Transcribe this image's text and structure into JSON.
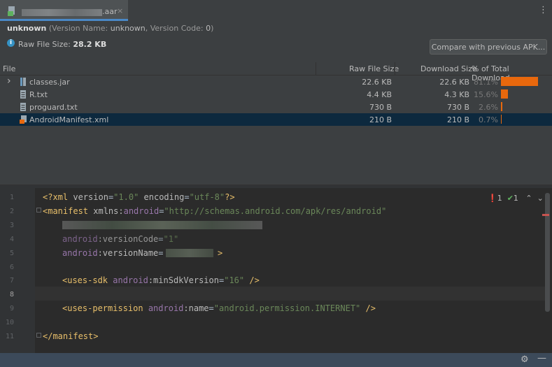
{
  "tab": {
    "filename_ext": ".aar",
    "close": "×"
  },
  "header": {
    "name": "unknown",
    "version_name_label": "(Version Name: ",
    "version_name": "unknown",
    "version_code_label": ", Version Code: ",
    "version_code": "0",
    "version_close": ")",
    "raw_size_label": "Raw File Size: ",
    "raw_size": "28.2 KB",
    "compare_button": "Compare with previous APK..."
  },
  "table": {
    "columns": [
      "File",
      "Raw File Size",
      "Download Size",
      "% of Total Download..."
    ],
    "rows": [
      {
        "name": "classes.jar",
        "raw": "22.6 KB",
        "download": "22.6 KB",
        "percent": "81.1%",
        "percent_value": 81.1,
        "icon": "jar-icon",
        "expandable": true
      },
      {
        "name": "R.txt",
        "raw": "4.4 KB",
        "download": "4.3 KB",
        "percent": "15.6%",
        "percent_value": 15.6,
        "icon": "text-file-icon",
        "expandable": false
      },
      {
        "name": "proguard.txt",
        "raw": "730 B",
        "download": "730 B",
        "percent": "2.6%",
        "percent_value": 2.6,
        "icon": "text-file-icon",
        "expandable": false
      },
      {
        "name": "AndroidManifest.xml",
        "raw": "210 B",
        "download": "210 B",
        "percent": "0.7%",
        "percent_value": 0.7,
        "icon": "xml-file-icon",
        "expandable": false,
        "selected": true
      }
    ]
  },
  "editor": {
    "line_numbers": [
      "1",
      "2",
      "3",
      "4",
      "5",
      "6",
      "7",
      "8",
      "9",
      "10",
      "11"
    ],
    "current_line": "8",
    "l1": {
      "a": "<?xml ",
      "b": "version",
      "c": "=",
      "d": "\"1.0\"",
      "e": " ",
      "f": "encoding",
      "g": "=",
      "h": "\"utf-8\"",
      "i": "?>"
    },
    "l2": {
      "tag": "<manifest ",
      "a": "xmlns:",
      "ns": "android",
      "eq": "=",
      "val": "\"http://schemas.android.com/apk/res/android\""
    },
    "l4": {
      "ns": "android",
      "attr": ":versionCode",
      "eq": "=",
      "val": "\"1\""
    },
    "l5": {
      "ns": "android",
      "attr": ":versionName",
      "eq": "=",
      "end": ">"
    },
    "l7": {
      "tag": "<uses-sdk ",
      "ns": "android",
      "attr": ":minSdkVersion",
      "eq": "=",
      "val": "\"16\"",
      "end": " />"
    },
    "l9": {
      "tag": "<uses-permission ",
      "ns": "android",
      "attr": ":name",
      "eq": "=",
      "val": "\"android.permission.INTERNET\"",
      "end": " />"
    },
    "l11": {
      "tag": "</manifest>"
    },
    "inspections": {
      "errors": "1",
      "ok": "1"
    }
  },
  "colors": {
    "accent": "#4a88c7",
    "bar": "#e8680d",
    "selection": "#0d293e"
  }
}
